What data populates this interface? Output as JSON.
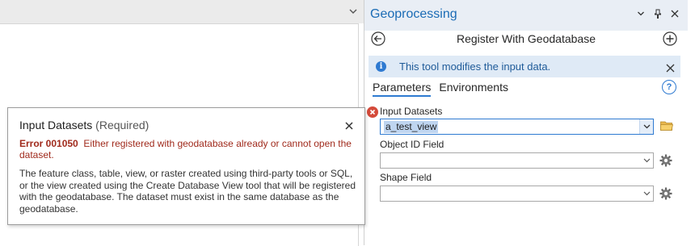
{
  "panel": {
    "title": "Geoprocessing",
    "tool_title": "Register With Geodatabase"
  },
  "info_bar": {
    "text": "This tool modifies the input data."
  },
  "tabs": [
    {
      "label": "Parameters",
      "active": true
    },
    {
      "label": "Environments",
      "active": false
    }
  ],
  "params": {
    "input_datasets": {
      "label": "Input Datasets",
      "value": "a_test_view",
      "status": "error"
    },
    "object_id_field": {
      "label": "Object ID Field",
      "value": ""
    },
    "shape_field": {
      "label": "Shape Field",
      "value": ""
    }
  },
  "tooltip": {
    "title": "Input Datasets",
    "required": "(Required)",
    "error_code": "Error 001050",
    "error_message": "Either registered with geodatabase already or cannot open the dataset.",
    "description": "The feature class, table, view, or raster created using third-party tools or SQL, or the view created using the Create Database View tool that will be registered with the geodatabase. The dataset must exist in the same database as the geodatabase."
  },
  "icons": {
    "panel_menu": "chevron-down-icon",
    "pin": "pin-icon",
    "close": "close-icon",
    "back": "back-arrow-icon",
    "add": "plus-circle-icon",
    "info": "info-icon",
    "help": "help-icon",
    "error": "error-icon",
    "browse": "folder-icon",
    "properties": "gear-icon"
  },
  "colors": {
    "accent": "#2e7ad1",
    "title_blue": "#1a6bb5",
    "error_red": "#a02a1c",
    "info_bar_bg": "#dfeaf6"
  }
}
